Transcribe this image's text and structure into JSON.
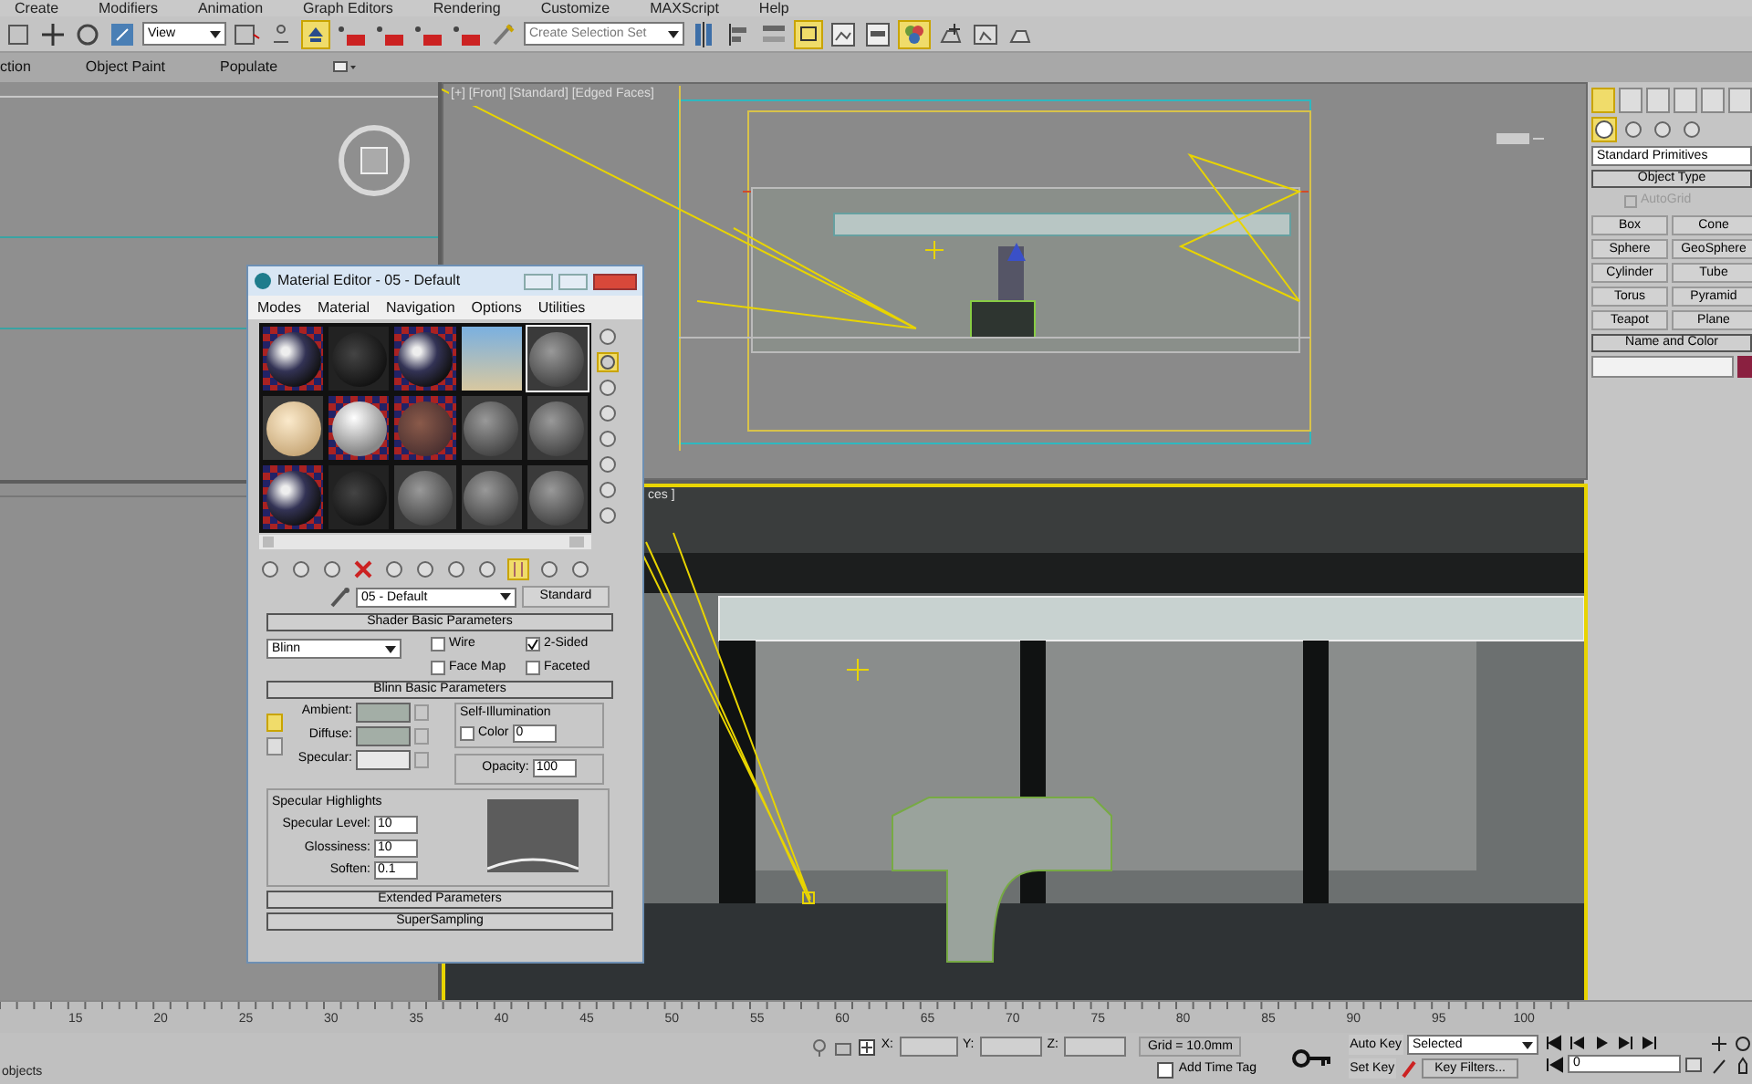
{
  "menu_bar": [
    "Create",
    "Modifiers",
    "Animation",
    "Graph Editors",
    "Rendering",
    "Customize",
    "MAXScript",
    "Help"
  ],
  "toolbar": {
    "reference_dropdown": "View",
    "selection_set_dropdown": "Create Selection Set"
  },
  "ribbon_tabs": [
    "ction",
    "Object Paint",
    "Populate"
  ],
  "viewports": [
    {
      "label": "[+] [Front] [Standard] [Edged Faces]",
      "active": false
    },
    {
      "label": "ces ]",
      "active": true
    }
  ],
  "material_editor": {
    "title": "Material Editor - 05 - Default",
    "menus": [
      "Modes",
      "Material",
      "Navigation",
      "Options",
      "Utilities"
    ],
    "slots": [
      {
        "kind": "checker",
        "selected": false
      },
      {
        "kind": "dark",
        "selected": false
      },
      {
        "kind": "checker",
        "selected": false
      },
      {
        "kind": "sky",
        "selected": false
      },
      {
        "kind": "gray",
        "selected": true
      },
      {
        "kind": "cream",
        "selected": false
      },
      {
        "kind": "white",
        "selected": false
      },
      {
        "kind": "brown",
        "selected": false
      },
      {
        "kind": "gray",
        "selected": false
      },
      {
        "kind": "gray",
        "selected": false
      },
      {
        "kind": "checker",
        "selected": false
      },
      {
        "kind": "dark",
        "selected": false
      },
      {
        "kind": "gray",
        "selected": false
      },
      {
        "kind": "gray",
        "selected": false
      },
      {
        "kind": "gray",
        "selected": false
      }
    ],
    "material_name": "05 - Default",
    "material_type": "Standard",
    "shader_rollout": {
      "title": "Shader Basic Parameters",
      "shader": "Blinn",
      "options": [
        {
          "label": "Wire",
          "checked": false
        },
        {
          "label": "2-Sided",
          "checked": true
        },
        {
          "label": "Face Map",
          "checked": false
        },
        {
          "label": "Faceted",
          "checked": false
        }
      ]
    },
    "blinn_rollout": {
      "title": "Blinn Basic Parameters",
      "colors": [
        {
          "label": "Ambient:",
          "color": "#a3aea6"
        },
        {
          "label": "Diffuse:",
          "color": "#a3aea6"
        },
        {
          "label": "Specular:",
          "color": "#e8e8e8"
        }
      ],
      "self_illumination": {
        "title": "Self-Illumination",
        "label": "Color",
        "checked": false,
        "value": "0"
      },
      "opacity": {
        "label": "Opacity:",
        "value": "100"
      },
      "specular_highlights": {
        "title": "Specular Highlights",
        "fields": [
          {
            "label": "Specular Level:",
            "value": "10"
          },
          {
            "label": "Glossiness:",
            "value": "10"
          },
          {
            "label": "Soften:",
            "value": "0.1"
          }
        ]
      }
    },
    "collapsed_rollouts": [
      "Extended Parameters",
      "SuperSampling"
    ]
  },
  "command_panel": {
    "category": "Standard Primitives",
    "object_type_title": "Object Type",
    "autogrid": {
      "label": "AutoGrid",
      "checked": false
    },
    "buttons": [
      "Box",
      "Cone",
      "Sphere",
      "GeoSphere",
      "Cylinder",
      "Tube",
      "Torus",
      "Pyramid",
      "Teapot",
      "Plane"
    ],
    "name_and_color_title": "Name and Color",
    "color": "#8a2040"
  },
  "timeline": {
    "ticks": [
      "15",
      "20",
      "25",
      "30",
      "35",
      "40",
      "45",
      "50",
      "55",
      "60",
      "65",
      "70",
      "75",
      "80",
      "85",
      "90",
      "95",
      "100"
    ]
  },
  "status_bar": {
    "prompt": "objects",
    "coords": [
      "X:",
      "Y:",
      "Z:"
    ],
    "grid": "Grid = 10.0mm",
    "time_tag": "Add Time Tag",
    "auto_key": "Auto Key",
    "key_mode": "Selected",
    "set_key": "Set Key",
    "key_filters": "Key Filters...",
    "frame": "0"
  }
}
